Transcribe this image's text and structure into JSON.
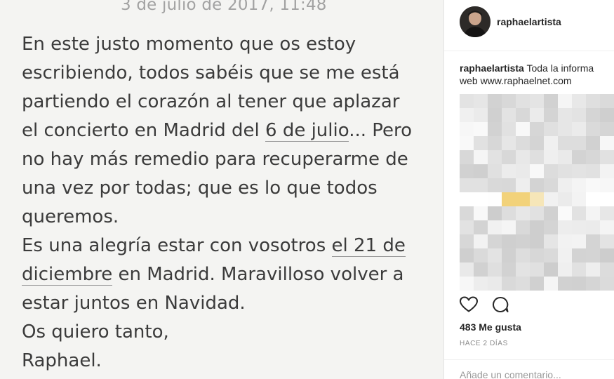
{
  "note": {
    "date": "3 de julio de 2017, 11:48",
    "paragraph1": {
      "line1": "En este justo momento que os estoy",
      "line2": "escribiendo, todos sabéis que se me está",
      "line3": "partiendo el corazón al tener que aplazar",
      "line4_pre": "el concierto en Madrid del ",
      "line4_link": "6 de julio",
      "line4_post": "... Pero",
      "line5": "no hay más remedio para recuperarme de",
      "line6": "una vez por todas; que es lo que todos",
      "line7": "queremos."
    },
    "paragraph2": {
      "line1_pre": "Es una alegría estar con vosotros ",
      "line1_link": "el 21 de",
      "line2_link": "diciembre",
      "line2_post": " en Madrid. Maravilloso volver a",
      "line3": "estar juntos en Navidad."
    },
    "line_quiero": "Os quiero tanto,",
    "signature": "Raphael."
  },
  "post": {
    "username": "raphaelartista",
    "caption_user": "raphaelartista",
    "caption_text": " Toda la informa",
    "caption_line2": "web www.raphaelnet.com",
    "likes": "483 Me gusta",
    "time_ago": "HACE 2 DÍAS",
    "comment_placeholder": "Añade un comentario..."
  },
  "icons": {
    "like": "heart-icon",
    "comment": "comment-icon",
    "avatar": "profile-photo"
  },
  "colors": {
    "note_background": "#f4f4f2",
    "note_text": "#3b3b3b",
    "date_text": "#a2a2a2",
    "username_text": "#262626",
    "blur_accent": "#f2d27a"
  }
}
